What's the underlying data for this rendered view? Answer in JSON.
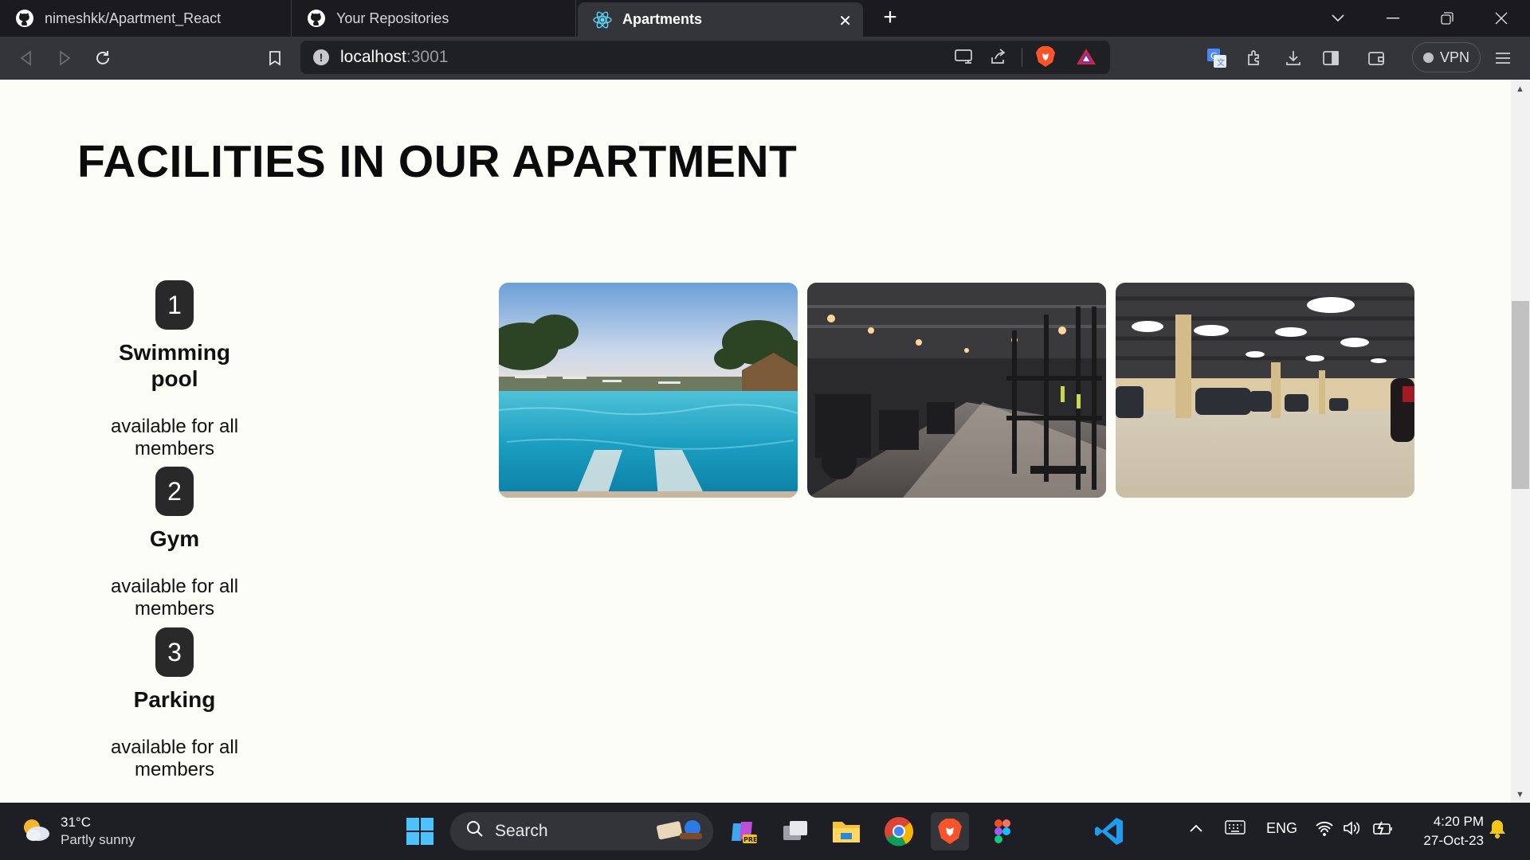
{
  "browser": {
    "tabs": [
      {
        "label": "nimeshkk/Apartment_React",
        "icon": "github-icon"
      },
      {
        "label": "Your Repositories",
        "icon": "github-icon"
      },
      {
        "label": "Apartments",
        "icon": "react-icon"
      }
    ],
    "url_host": "localhost",
    "url_port": ":3001",
    "vpn_label": "VPN"
  },
  "page": {
    "heading": "FACILITIES IN OUR APARTMENT",
    "facilities": [
      {
        "number": "1",
        "name": "Swimming pool",
        "description": "available for all members"
      },
      {
        "number": "2",
        "name": "Gym",
        "description": "available for all members"
      },
      {
        "number": "3",
        "name": "Parking",
        "description": "available for all members"
      }
    ],
    "photos": [
      {
        "subject": "swimming pool photo"
      },
      {
        "subject": "gym photo"
      },
      {
        "subject": "parking garage photo"
      }
    ]
  },
  "taskbar": {
    "weather_temp": "31°C",
    "weather_condition": "Partly sunny",
    "search_placeholder": "Search",
    "language": "ENG",
    "time": "4:20 PM",
    "date": "27-Oct-23"
  },
  "colors": {
    "tab_bg": "#1b1b1f",
    "toolbar_bg": "#34353a",
    "page_bg": "#fdfdf8",
    "badge_bg": "#292929",
    "brave_orange": "#fb542b"
  }
}
